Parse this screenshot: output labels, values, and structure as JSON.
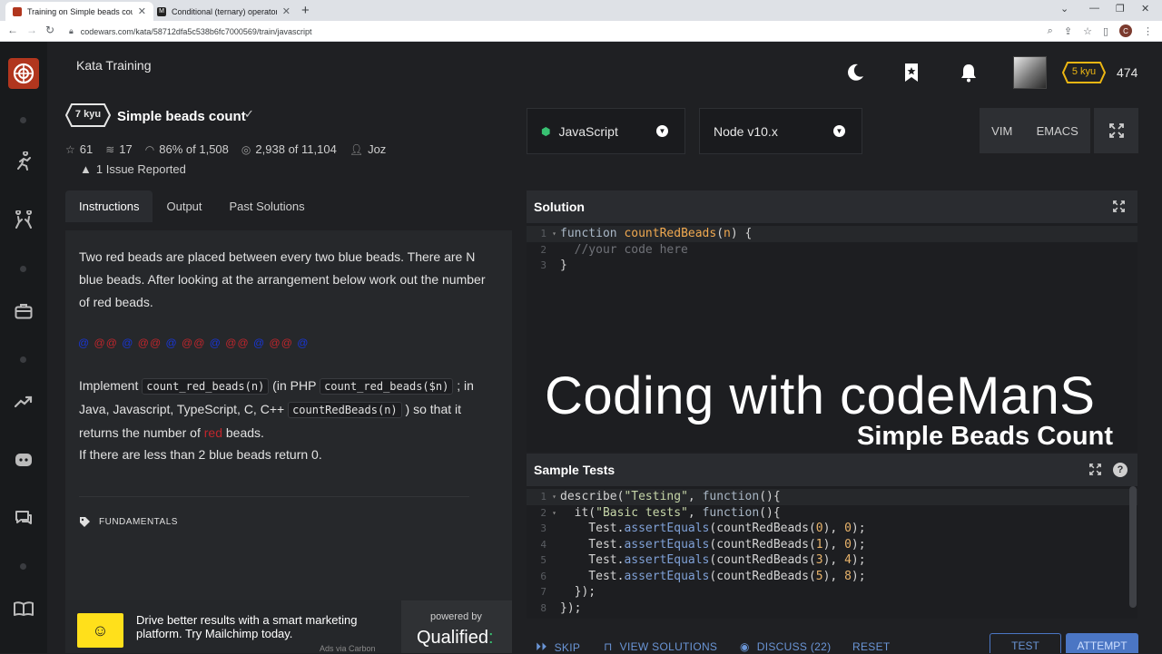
{
  "browser": {
    "tabs": [
      {
        "title": "Training on Simple beads count |",
        "favicon_color": "#b1361e"
      },
      {
        "title": "Conditional (ternary) operator - J",
        "favicon_color": "#222222"
      }
    ],
    "url": "codewars.com/kata/58712dfa5c538b6fc7000569/train/javascript",
    "profile_initial": "C"
  },
  "header": {
    "section_title": "Kata Training",
    "rank": "5 kyu",
    "honor": "474"
  },
  "kata": {
    "kyu": "7 kyu",
    "title": "Simple beads count",
    "check": "✓",
    "stars": "61",
    "collections": "17",
    "satisfaction": "86%",
    "satisfaction_of": "of 1,508",
    "completed": "2,938",
    "completed_of": "of 11,104",
    "author": "Joz",
    "issues": "1 Issue Reported"
  },
  "left_tabs": [
    "Instructions",
    "Output",
    "Past Solutions"
  ],
  "instructions": {
    "p1": "Two red beads are placed between every two blue beads. There are N blue beads. After looking at the arrangement below work out the number of red beads.",
    "beads": [
      "@",
      "@@",
      "@",
      "@@",
      "@",
      "@@",
      "@",
      "@@",
      "@",
      "@@",
      "@"
    ],
    "p2_a": "Implement ",
    "p2_code1": "count_red_beads(n)",
    "p2_b": " (in PHP ",
    "p2_code2": "count_red_beads($n)",
    "p2_c": " ; in Java, Javascript, TypeScript, C, C++ ",
    "p2_code3": "countRedBeads(n)",
    "p2_d": " ) so that it returns the number of ",
    "p2_red": "red",
    "p2_e": " beads.",
    "p3": "If there are less than 2 blue beads return 0.",
    "tag": "FUNDAMENTALS"
  },
  "ad": {
    "text": "Drive better results with a smart marketing platform. Try Mailchimp today.",
    "via": "Ads via Carbon",
    "powered_by": "powered by",
    "brand": "Qualified",
    "brand_mark": ":"
  },
  "editor": {
    "language": "JavaScript",
    "version": "Node v10.x",
    "keymaps": [
      "VIM",
      "EMACS"
    ],
    "solution_title": "Solution",
    "solution_lines": [
      {
        "n": "1",
        "fold": "▾"
      },
      {
        "n": "2",
        "fold": ""
      },
      {
        "n": "3",
        "fold": ""
      }
    ],
    "solution_code": {
      "l1_kw": "function ",
      "l1_fn": "countRedBeads",
      "l1_p1": "(",
      "l1_arg": "n",
      "l1_p2": ") {",
      "l2": "  //your code here",
      "l3": "}"
    },
    "tests_title": "Sample Tests",
    "test_lines": [
      {
        "n": "1",
        "fold": "▾"
      },
      {
        "n": "2",
        "fold": "▾"
      },
      {
        "n": "3",
        "fold": ""
      },
      {
        "n": "4",
        "fold": ""
      },
      {
        "n": "5",
        "fold": ""
      },
      {
        "n": "6",
        "fold": ""
      },
      {
        "n": "7",
        "fold": ""
      },
      {
        "n": "8",
        "fold": ""
      }
    ],
    "tests_code": {
      "l1_a": "describe(",
      "l1_str": "\"Testing\"",
      "l1_b": ", ",
      "l1_kw": "function",
      "l1_c": "(){",
      "l2_a": "  it(",
      "l2_str": "\"Basic tests\"",
      "l2_b": ", ",
      "l2_kw": "function",
      "l2_c": "(){",
      "asserts": [
        {
          "arg": "0",
          "exp": "0"
        },
        {
          "arg": "1",
          "exp": "0"
        },
        {
          "arg": "3",
          "exp": "4"
        },
        {
          "arg": "5",
          "exp": "8"
        }
      ],
      "assert_obj": "    Test",
      "assert_dot": ".",
      "assert_fn": "assertEquals",
      "assert_call": "(countRedBeads(",
      "assert_mid": "), ",
      "assert_end": ");",
      "l7": "  });",
      "l8": "});"
    }
  },
  "watermark": {
    "line1": "Coding with codeManS",
    "line2": "Simple Beads Count"
  },
  "actions": {
    "skip": "SKIP",
    "view_solutions": "VIEW SOLUTIONS",
    "discuss": "DISCUSS (22)",
    "reset": "RESET",
    "test": "TEST",
    "attempt": "ATTEMPT"
  },
  "colors": {
    "brand": "#b1361e",
    "rank_yellow": "#ecb613",
    "action_blue": "#4b76c4",
    "bead_blue": "#1836d6",
    "bead_red": "#c0262c"
  }
}
